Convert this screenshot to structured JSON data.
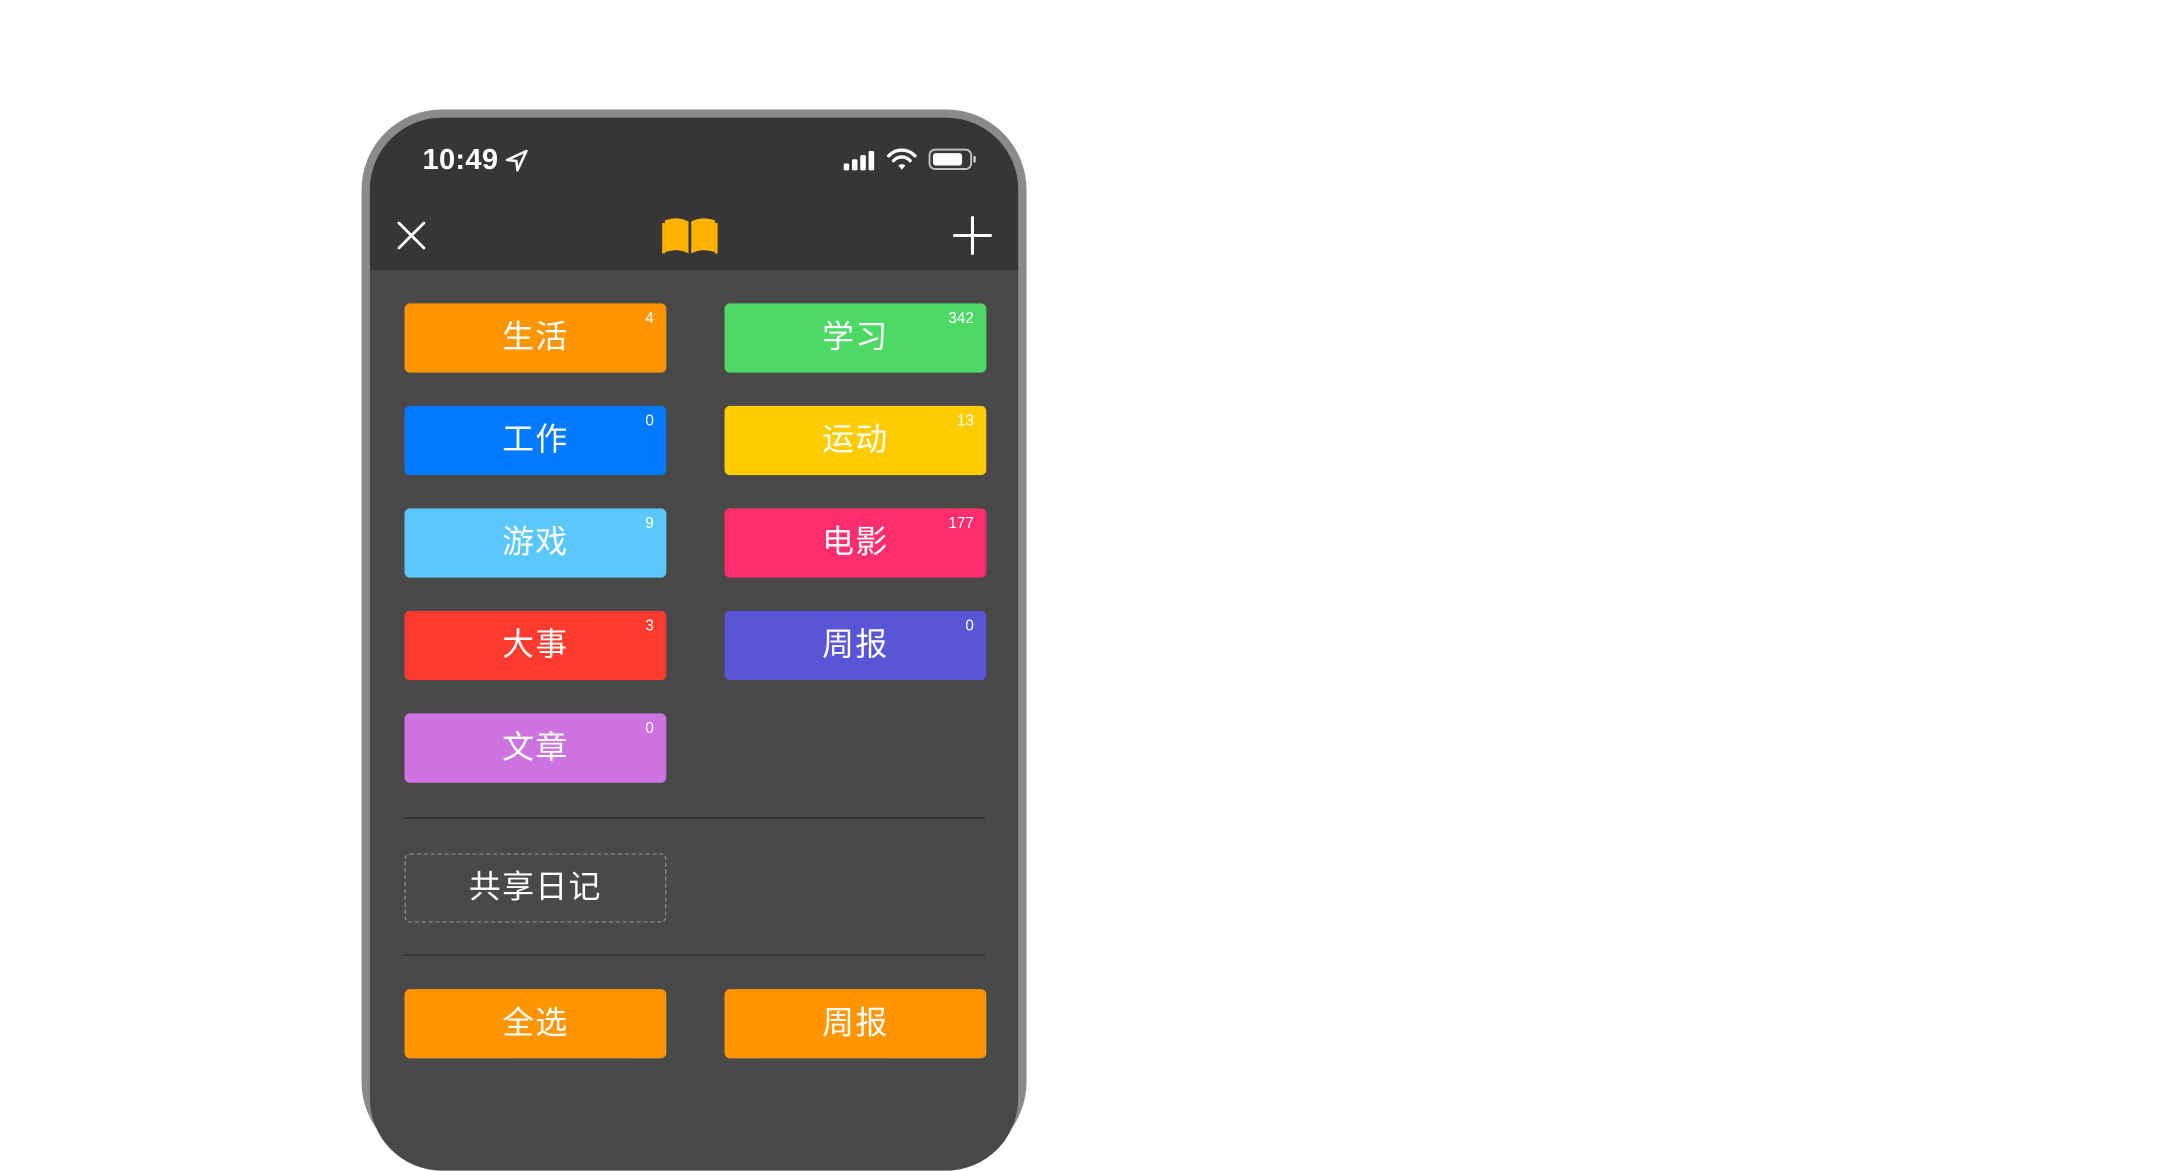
{
  "status_bar": {
    "time": "10:49",
    "location_icon": "location-arrow-icon",
    "signal_icon": "cellular-signal-icon",
    "wifi_icon": "wifi-icon",
    "battery_icon": "battery-icon"
  },
  "nav": {
    "close_icon": "close-icon",
    "center_icon": "open-book-icon",
    "add_icon": "plus-icon",
    "book_color": "#FFB300"
  },
  "categories": [
    {
      "label": "生活",
      "count": "4",
      "color": "#FF9500"
    },
    {
      "label": "学习",
      "count": "342",
      "color": "#4CD964"
    },
    {
      "label": "工作",
      "count": "0",
      "color": "#007AFF"
    },
    {
      "label": "运动",
      "count": "13",
      "color": "#FFCC00"
    },
    {
      "label": "游戏",
      "count": "9",
      "color": "#5AC8FA"
    },
    {
      "label": "电影",
      "count": "177",
      "color": "#FF2D6D"
    },
    {
      "label": "大事",
      "count": "3",
      "color": "#FF3B30"
    },
    {
      "label": "周报",
      "count": "0",
      "color": "#5856D6"
    },
    {
      "label": "文章",
      "count": "0",
      "color": "#CC73E1"
    }
  ],
  "shared": {
    "label": "共享日记"
  },
  "actions": [
    {
      "label": "全选",
      "color": "#FF9500"
    },
    {
      "label": "周报",
      "color": "#FF9500"
    }
  ],
  "colors": {
    "header_bg": "#363636",
    "content_bg": "#494949",
    "frame": "#8A8A8A"
  }
}
